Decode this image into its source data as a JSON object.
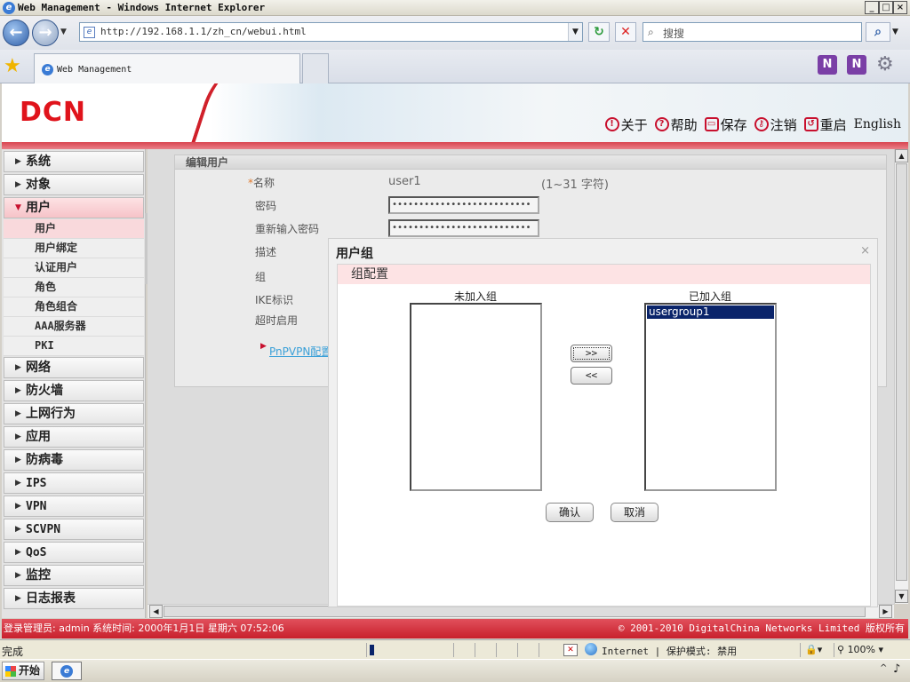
{
  "window": {
    "title": "Web Management - Windows Internet Explorer",
    "minimize": "_",
    "maximize": "□",
    "close": "×"
  },
  "browser": {
    "url": "http://192.168.1.1/zh_cn/webui.html",
    "search_placeholder": "搜搜",
    "tab_title": "Web Management"
  },
  "banner": {
    "logo": "DCN",
    "menu": {
      "about": "关于",
      "help": "帮助",
      "save": "保存",
      "logout": "注销",
      "reboot": "重启",
      "language": "English"
    }
  },
  "sidebar": {
    "items": [
      {
        "label": "系统"
      },
      {
        "label": "对象"
      },
      {
        "label": "用户",
        "open": true
      },
      {
        "label": "网络"
      },
      {
        "label": "防火墙"
      },
      {
        "label": "上网行为"
      },
      {
        "label": "应用"
      },
      {
        "label": "防病毒"
      },
      {
        "label": "IPS"
      },
      {
        "label": "VPN"
      },
      {
        "label": "SCVPN"
      },
      {
        "label": "QoS"
      },
      {
        "label": "监控"
      },
      {
        "label": "日志报表"
      }
    ],
    "user_subitems": [
      "用户",
      "用户绑定",
      "认证用户",
      "角色",
      "角色组合",
      "AAA服务器",
      "PKI"
    ]
  },
  "edit_user": {
    "header": "编辑用户",
    "name_label": "名称",
    "name_value": "user1",
    "name_hint": "(1~31 字符)",
    "password_label": "密码",
    "password_value": "••••••••••••••••••••••••••",
    "confirm_label": "重新输入密码",
    "confirm_value": "••••••••••••••••••••••••••",
    "desc_label": "描述",
    "group_label": "组",
    "ike_label": "IKE标识",
    "timeout_label": "超时启用",
    "pnp_link": "PnPVPN配置"
  },
  "dialog": {
    "title": "用户组",
    "close": "×",
    "section": "组配置",
    "available_header": "未加入组",
    "joined_header": "已加入组",
    "joined_items": [
      "usergroup1"
    ],
    "add_btn": ">>",
    "remove_btn": "<<",
    "ok": "确认",
    "cancel": "取消"
  },
  "footer": {
    "left": "登录管理员: admin 系统时间: 2000年1月1日 星期六 07:52:06",
    "right": "© 2001-2010 DigitalChina Networks Limited 版权所有"
  },
  "statusbar": {
    "done": "完成",
    "zone": "Internet | 保护模式: 禁用",
    "zoom": "100%"
  },
  "taskbar": {
    "start": "开始"
  }
}
